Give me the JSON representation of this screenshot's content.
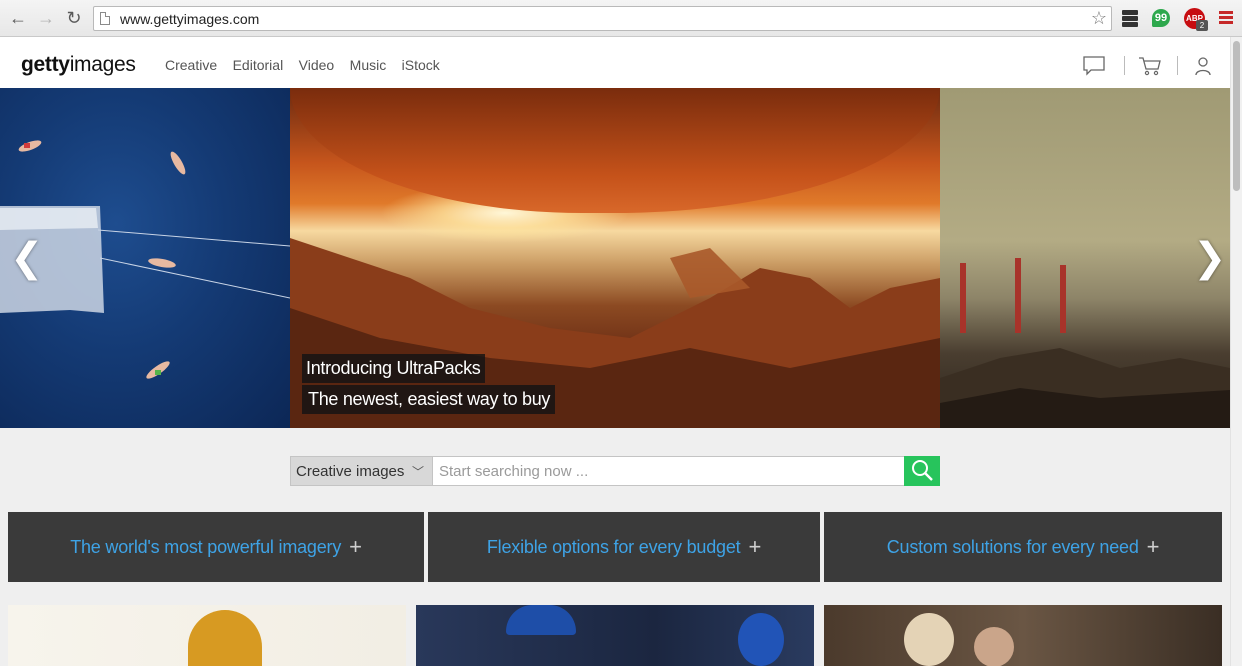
{
  "browser": {
    "url": "www.gettyimages.com",
    "abp_label": "ABP",
    "abp_badge": "2",
    "hangouts_label": "99"
  },
  "site": {
    "logo_bold": "getty",
    "logo_light": "images",
    "nav": [
      "Creative",
      "Editorial",
      "Video",
      "Music",
      "iStock"
    ]
  },
  "hero": {
    "caption_line1": "Introducing UltraPacks",
    "caption_line2": "The newest, easiest way to buy",
    "prev_arrow": "❮",
    "next_arrow": "❯"
  },
  "search": {
    "category": "Creative images",
    "placeholder": "Start searching now ..."
  },
  "value_props": [
    {
      "label": "The world's most powerful imagery"
    },
    {
      "label": "Flexible options for every budget"
    },
    {
      "label": "Custom solutions for every need"
    }
  ],
  "colors": {
    "link_blue": "#3ea3e6",
    "search_green": "#27c45c",
    "panel_dark": "#3a3a3a"
  }
}
